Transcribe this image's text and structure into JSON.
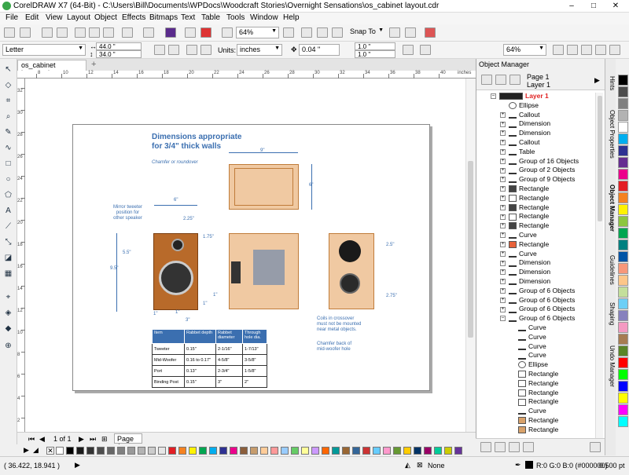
{
  "window": {
    "title": "CorelDRAW X7 (64-Bit) - C:\\Users\\Bill\\Documents\\WPDocs\\Woodcraft Stories\\Overnight Sensations\\os_cabinet layout.cdr",
    "min": "–",
    "max": "□",
    "close": "✕"
  },
  "menus": [
    "File",
    "Edit",
    "View",
    "Layout",
    "Object",
    "Effects",
    "Bitmaps",
    "Text",
    "Table",
    "Tools",
    "Window",
    "Help"
  ],
  "toolbar": {
    "zoom": "64%",
    "snap": "Snap To"
  },
  "propbar": {
    "paper": "Letter",
    "width": "44.0 \"",
    "height": "34.0 \"",
    "units_label": "Units:",
    "units": "inches",
    "nudge": "0.04 \"",
    "dup_x": "1.0 \"",
    "dup_y": "1.0 \"",
    "zoom": "64%"
  },
  "document": {
    "tab": "os_cabinet layout.cdr",
    "title_line1": "Dimensions appropriate",
    "title_line2": "for 3/4\" thick walls",
    "chamfer_note": "Chamfer or roundover",
    "mirror_note1": "Mirror tweeter",
    "mirror_note2": "position for",
    "mirror_note3": "other speaker",
    "coils_note1": "Coils in crossover",
    "coils_note2": "must not be mounted",
    "coils_note3": "near metal objects.",
    "chamfer_back1": "Chamfer back of",
    "chamfer_back2": "mid-woofer hole",
    "dims": {
      "top9": "9\"",
      "side6": "6\"",
      "front6": "6\"",
      "d225": "2.25\"",
      "d175": "1.75\"",
      "d55": "5.5\"",
      "d95": "9.5\"",
      "d1a": "1\"",
      "d1b": "1\"",
      "d3": "3\"",
      "d1c": "1\"",
      "d1d": "1\"",
      "d25": "2.5\"",
      "d275": "2.75\""
    },
    "table": {
      "headers": [
        "Item",
        "Rabbet depth",
        "Rabbet diameter",
        "Through hole dia."
      ],
      "rows": [
        [
          "Tweeter",
          "0.15\"",
          "2-1/16\"",
          "1-7/13\""
        ],
        [
          "Mid-Woofer",
          "0.16 to 0.17\"",
          "4-5/8\"",
          "3-5/8\""
        ],
        [
          "Port",
          "0.13\"",
          "2-3/4\"",
          "1-5/8\""
        ],
        [
          "Binding Post",
          "0.15\"",
          "3\"",
          "2\""
        ]
      ]
    }
  },
  "ruler": {
    "unit": "inches",
    "h_nums": [
      "8",
      "10",
      "12",
      "14",
      "16",
      "18",
      "20",
      "22",
      "24",
      "26",
      "28",
      "30",
      "32",
      "34",
      "36",
      "38",
      "40"
    ],
    "v_nums": [
      "32",
      "30",
      "28",
      "26",
      "24",
      "22",
      "20",
      "18",
      "16",
      "14",
      "12",
      "10",
      "8",
      "6",
      "4",
      "2"
    ]
  },
  "pager": {
    "count": "1 of 1",
    "page_tab": "Page 1"
  },
  "status": {
    "coords": "( 36.422, 18.941 )",
    "fill": "None",
    "color_info": "R:0 G:0 B:0 (#000000)",
    "outline": "0.500 pt"
  },
  "object_manager": {
    "title": "Object Manager",
    "page": "Page 1",
    "layer": "Layer 1",
    "items": [
      {
        "label": "Layer 1",
        "icon": "layer",
        "level": 0,
        "exp": "–",
        "red": true
      },
      {
        "label": "Ellipse",
        "icon": "ellipse",
        "level": 1,
        "exp": ""
      },
      {
        "label": "Callout",
        "icon": "callout",
        "level": 1,
        "exp": "+"
      },
      {
        "label": "Dimension",
        "icon": "dimension",
        "level": 1,
        "exp": "+"
      },
      {
        "label": "Dimension",
        "icon": "dimension",
        "level": 1,
        "exp": "+"
      },
      {
        "label": "Callout",
        "icon": "callout",
        "level": 1,
        "exp": "+"
      },
      {
        "label": "Table",
        "icon": "table",
        "level": 1,
        "exp": "+"
      },
      {
        "label": "Group of 16 Objects",
        "icon": "group",
        "level": 1,
        "exp": "+"
      },
      {
        "label": "Group of 2 Objects",
        "icon": "group",
        "level": 1,
        "exp": "+"
      },
      {
        "label": "Group of 9 Objects",
        "icon": "group",
        "level": 1,
        "exp": "+"
      },
      {
        "label": "Rectangle",
        "icon": "rect-dark",
        "level": 1,
        "exp": "+"
      },
      {
        "label": "Rectangle",
        "icon": "rect-white",
        "level": 1,
        "exp": "+"
      },
      {
        "label": "Rectangle",
        "icon": "rect-dark",
        "level": 1,
        "exp": "+"
      },
      {
        "label": "Rectangle",
        "icon": "rect-white",
        "level": 1,
        "exp": "+"
      },
      {
        "label": "Rectangle",
        "icon": "rect-dark",
        "level": 1,
        "exp": "+"
      },
      {
        "label": "Curve",
        "icon": "curve",
        "level": 1,
        "exp": "+"
      },
      {
        "label": "Rectangle",
        "icon": "rect-orange",
        "level": 1,
        "exp": "+"
      },
      {
        "label": "Curve",
        "icon": "curve",
        "level": 1,
        "exp": "+"
      },
      {
        "label": "Dimension",
        "icon": "dimension-h",
        "level": 1,
        "exp": "+"
      },
      {
        "label": "Dimension",
        "icon": "dimension-h",
        "level": 1,
        "exp": "+"
      },
      {
        "label": "Dimension",
        "icon": "dimension",
        "level": 1,
        "exp": "+"
      },
      {
        "label": "Group of 6 Objects",
        "icon": "group",
        "level": 1,
        "exp": "+"
      },
      {
        "label": "Group of 6 Objects",
        "icon": "group",
        "level": 1,
        "exp": "+"
      },
      {
        "label": "Group of 6 Objects",
        "icon": "group",
        "level": 1,
        "exp": "+"
      },
      {
        "label": "Group of 6 Objects",
        "icon": "group",
        "level": 1,
        "exp": "–"
      },
      {
        "label": "Curve",
        "icon": "curve",
        "level": 2,
        "exp": ""
      },
      {
        "label": "Curve",
        "icon": "curve",
        "level": 2,
        "exp": ""
      },
      {
        "label": "Curve",
        "icon": "curve",
        "level": 2,
        "exp": ""
      },
      {
        "label": "Curve",
        "icon": "curve",
        "level": 2,
        "exp": ""
      },
      {
        "label": "Ellipse",
        "icon": "ellipse",
        "level": 2,
        "exp": ""
      },
      {
        "label": "Rectangle",
        "icon": "rect-white",
        "level": 2,
        "exp": ""
      },
      {
        "label": "Rectangle",
        "icon": "rect-white",
        "level": 2,
        "exp": ""
      },
      {
        "label": "Rectangle",
        "icon": "rect-white",
        "level": 2,
        "exp": ""
      },
      {
        "label": "Rectangle",
        "icon": "rect-white",
        "level": 2,
        "exp": ""
      },
      {
        "label": "Curve",
        "icon": "curve",
        "level": 2,
        "exp": ""
      },
      {
        "label": "Rectangle",
        "icon": "rect-tan",
        "level": 2,
        "exp": ""
      },
      {
        "label": "Rectangle",
        "icon": "rect-tan",
        "level": 2,
        "exp": ""
      }
    ]
  },
  "docker_tabs": [
    "Hints",
    "Object Properties",
    "Object Manager",
    "Guidelines",
    "Shaping",
    "Undo Manager"
  ],
  "palette": [
    "#ffffff",
    "#000000",
    "#1a1a1a",
    "#333333",
    "#4d4d4d",
    "#666666",
    "#808080",
    "#999999",
    "#b3b3b3",
    "#cccccc",
    "#e6e6e6",
    "#e31e24",
    "#f58220",
    "#fff200",
    "#00a651",
    "#00aeef",
    "#2e3192",
    "#ec008c",
    "#8b5e3c",
    "#c69c6d",
    "#ffcc99",
    "#ff9999",
    "#99ccff",
    "#66cc66",
    "#ffff99",
    "#cc99ff",
    "#ff6600",
    "#009999",
    "#996633",
    "#336699",
    "#cc3333",
    "#66ccff",
    "#ff99cc",
    "#669933",
    "#ffcc00",
    "#003366",
    "#990066",
    "#00cc99",
    "#cccc00",
    "#663399"
  ],
  "vpalette": [
    "#000000",
    "#4d4d4d",
    "#808080",
    "#b3b3b3",
    "#ffffff",
    "#00aeef",
    "#2e3192",
    "#662d91",
    "#ec008c",
    "#e31e24",
    "#f58220",
    "#fff200",
    "#8dc63f",
    "#00a651",
    "#008080",
    "#0054a6",
    "#f7977a",
    "#fdc689",
    "#c4df9b",
    "#6dcff6",
    "#8781bd",
    "#f49ac2",
    "#a67c52",
    "#598527",
    "#ff0000",
    "#00ff00",
    "#0000ff",
    "#ffff00",
    "#ff00ff",
    "#00ffff"
  ]
}
